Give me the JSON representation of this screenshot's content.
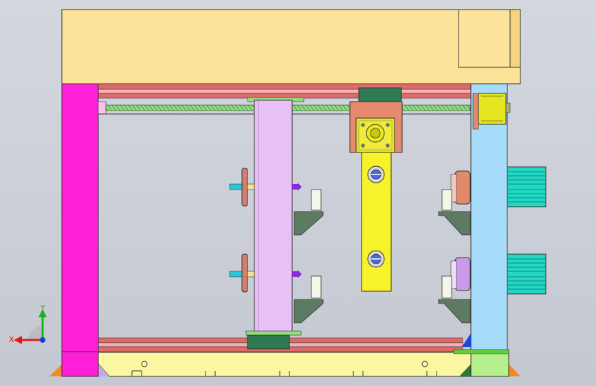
{
  "viewport": {
    "background": "#c8ccd4"
  },
  "triad": {
    "x_label": "X",
    "y_label": "Y",
    "x_color": "#e01818",
    "y_color": "#1ab01a",
    "z_color": "#1a3cd8"
  },
  "colors": {
    "top_beam": "#fde39a",
    "left_post": "#ff1fd9",
    "right_post": "#a6dcf9",
    "lead_screw": "#8fe07a",
    "moving_column": "#e8c0f5",
    "carriage_block": "#e58a6e",
    "yellow_arm": "#f8f22a",
    "base_plate": "#fbf6a0",
    "motor": "#22d7c4",
    "rails": "#e06a6a",
    "bracket": "#5d7a62"
  }
}
